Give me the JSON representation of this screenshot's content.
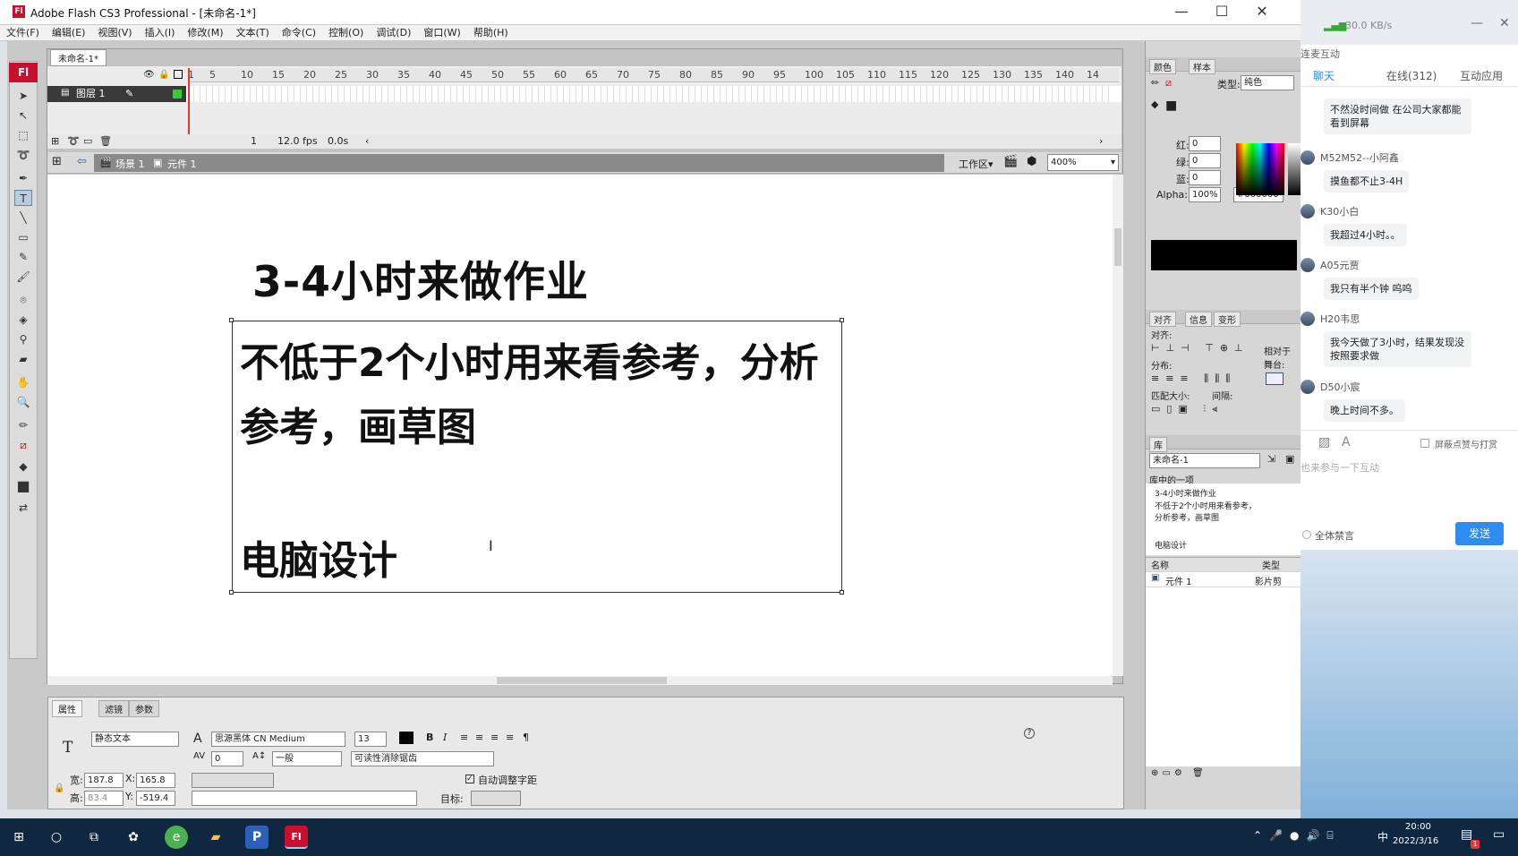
{
  "window": {
    "title": "Adobe Flash CS3 Professional - [未命名-1*]",
    "minimize": "—",
    "maximize": "☐",
    "close": "✕"
  },
  "menu": [
    "文件(F)",
    "编辑(E)",
    "视图(V)",
    "插入(I)",
    "修改(M)",
    "文本(T)",
    "命令(C)",
    "控制(O)",
    "调试(D)",
    "窗口(W)",
    "帮助(H)"
  ],
  "toolbox": {
    "badge": "Fl"
  },
  "document": {
    "tab": "未命名-1*"
  },
  "timeline": {
    "ruler": [
      "1",
      "5",
      "10",
      "15",
      "20",
      "25",
      "30",
      "35",
      "40",
      "45",
      "50",
      "55",
      "60",
      "65",
      "70",
      "75",
      "80",
      "85",
      "90",
      "95",
      "100",
      "105",
      "110",
      "115",
      "120",
      "125",
      "130",
      "135",
      "140",
      "14"
    ],
    "layer": "图层 1",
    "frame": "1",
    "fps": "12.0 fps",
    "time": "0.0s"
  },
  "editbar": {
    "scene": "场景 1",
    "symbol": "元件 1",
    "workspace": "工作区▾",
    "zoom": "400%"
  },
  "stage": {
    "heading": "3-4小时来做作业",
    "paragraph": "不低于2个小时用来看参考，分析参考，画草图",
    "footer": "电脑设计"
  },
  "properties": {
    "tabs": [
      "属性",
      "滤镜",
      "参数"
    ],
    "text_type": "静态文本",
    "font": "思源黑体 CN Medium",
    "size": "13",
    "letter_spacing": "0",
    "position": "一般",
    "render": "可读性消除锯齿",
    "w_label": "宽:",
    "w": "187.8",
    "x_label": "X:",
    "x": "165.8",
    "h_label": "高:",
    "h": "83.4",
    "y_label": "Y:",
    "y": "-519.4",
    "autokern": "自动调整字距",
    "target_label": "目标:"
  },
  "color_panel": {
    "tabs": [
      "颜色",
      "样本"
    ],
    "type_label": "类型:",
    "type": "纯色",
    "r_label": "红:",
    "r": "0",
    "g_label": "绿:",
    "g": "0",
    "b_label": "蓝:",
    "b": "0",
    "alpha_label": "Alpha:",
    "alpha": "100%",
    "hex": "#000000"
  },
  "align_panel": {
    "tabs": [
      "对齐",
      "信息",
      "变形"
    ],
    "align": "对齐:",
    "distribute": "分布:",
    "match": "匹配大小:",
    "spacing": "间隔:",
    "relative": "相对于舞台:"
  },
  "library_panel": {
    "tab": "库",
    "doc": "未命名-1",
    "count": "库中的一项",
    "preview": [
      "3-4小时来做作业",
      "不低于2个小时用来看参考，分析参考，画草图",
      "电脑设计"
    ],
    "col_name": "名称",
    "col_type": "类型",
    "item_name": "元件 1",
    "item_type": "影片剪"
  },
  "chat": {
    "speed": "30.0 KB/s",
    "header": "连麦互动",
    "tabs": [
      "聊天",
      "在线(312)",
      "互动应用"
    ],
    "messages": [
      {
        "name": "",
        "text": "不然没时间做 在公司大家都能看到屏幕"
      },
      {
        "name": "M52M52--小阿鑫",
        "text": "摸鱼都不止3-4H"
      },
      {
        "name": "K30小白",
        "text": "我超过4小时。。"
      },
      {
        "name": "A05元贾",
        "text": "我只有半个钟 呜呜"
      },
      {
        "name": "H20韦思",
        "text": "我今天做了3小时，结果发现没按照要求做"
      },
      {
        "name": "D50小宸",
        "text": "晚上时间不多。"
      }
    ],
    "block_likes": "屏蔽点赞与打赏",
    "input_placeholder": "也来参与一下互动",
    "mute_all": "全体禁言",
    "send": "发送"
  },
  "taskbar": {
    "clock_time": "20:00",
    "clock_date": "2022/3/16",
    "ime": "中",
    "badge": "1"
  },
  "colors": {
    "flash_red": "#c8102e",
    "taskbar": "#10283f",
    "send_blue": "#2f8cf0"
  }
}
